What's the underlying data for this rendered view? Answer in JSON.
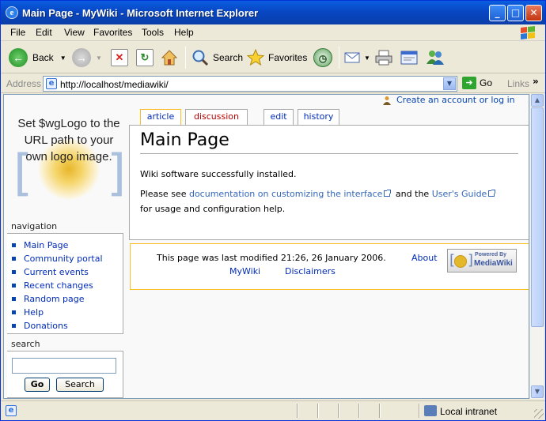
{
  "window": {
    "title": "Main Page - MyWiki - Microsoft Internet Explorer",
    "minimize": "_",
    "maximize": "□",
    "close": "✕"
  },
  "menu": [
    "File",
    "Edit",
    "View",
    "Favorites",
    "Tools",
    "Help"
  ],
  "toolbar": {
    "back_label": "Back",
    "search_label": "Search",
    "favorites_label": "Favorites"
  },
  "address": {
    "label": "Address",
    "url": "http://localhost/mediawiki/",
    "go_label": "Go",
    "links_label": "Links"
  },
  "wiki": {
    "logo_text": "Set $wgLogo to the URL path to your own logo image.",
    "user_link": "Create an account or log in",
    "tabs": {
      "article": "article",
      "discussion": "discussion",
      "edit": "edit",
      "history": "history"
    },
    "navigation": {
      "heading": "navigation",
      "items": [
        "Main Page",
        "Community portal",
        "Current events",
        "Recent changes",
        "Random page",
        "Help",
        "Donations"
      ]
    },
    "search": {
      "heading": "search",
      "go_label": "Go",
      "search_label": "Search",
      "value": ""
    },
    "article": {
      "title": "Main Page",
      "line1": "Wiki software successfully installed.",
      "line2_pre": "Please see ",
      "line2_link1": "documentation on customizing the interface",
      "line2_mid": " and the ",
      "line2_link2": "User's Guide",
      "line3": "for usage and configuration help."
    },
    "footer": {
      "last_modified": "This page was last modified 21:26, 26 January 2006.",
      "about": "About",
      "mywiki": "MyWiki",
      "disclaimers": "Disclaimers",
      "powered_top": "Powered By",
      "powered_bottom": "MediaWiki"
    }
  },
  "status": {
    "zone": "Local intranet"
  },
  "colors": {
    "link": "#0645ad",
    "new_link": "#ba0000",
    "active_tab_border": "#fabd23",
    "titlebar": "#0847c4"
  }
}
